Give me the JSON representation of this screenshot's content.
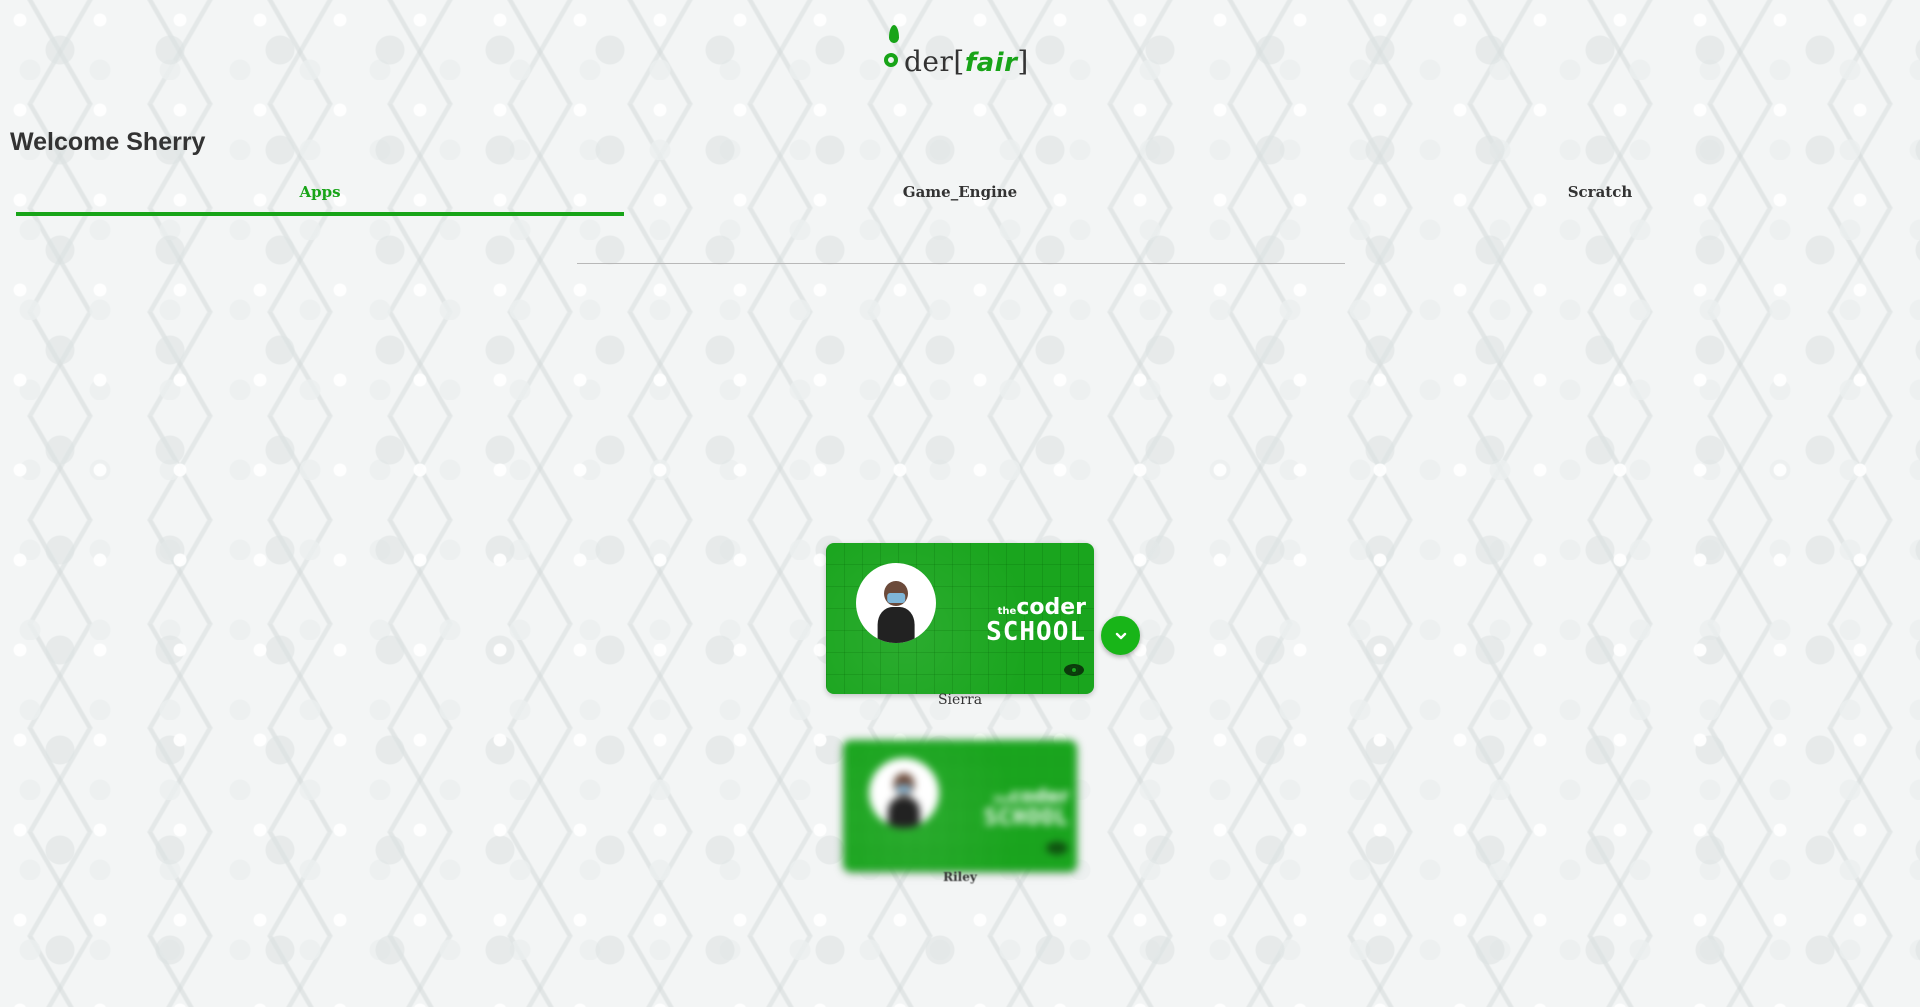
{
  "logo": {
    "text_coder": "c der",
    "text_fair": "fair",
    "bracket_open": "[",
    "bracket_close": "]"
  },
  "welcome": "Welcome Sherry",
  "tabs": [
    {
      "label": "Apps",
      "active": true
    },
    {
      "label": "Game_Engine",
      "active": false
    },
    {
      "label": "Scratch",
      "active": false
    }
  ],
  "cards": [
    {
      "name": "Sierra",
      "logo_the": "the",
      "logo_coder": "coder",
      "logo_school": "SCHOOL",
      "icon": "eye-icon"
    },
    {
      "name": "Riley",
      "logo_the": "the",
      "logo_coder": "coder",
      "logo_school": "SCHOOL",
      "icon": "eye-icon"
    }
  ],
  "expand_icon": "chevron-down-icon",
  "colors": {
    "accent": "#18a418",
    "card": "#1aa51e",
    "text": "#333333"
  }
}
